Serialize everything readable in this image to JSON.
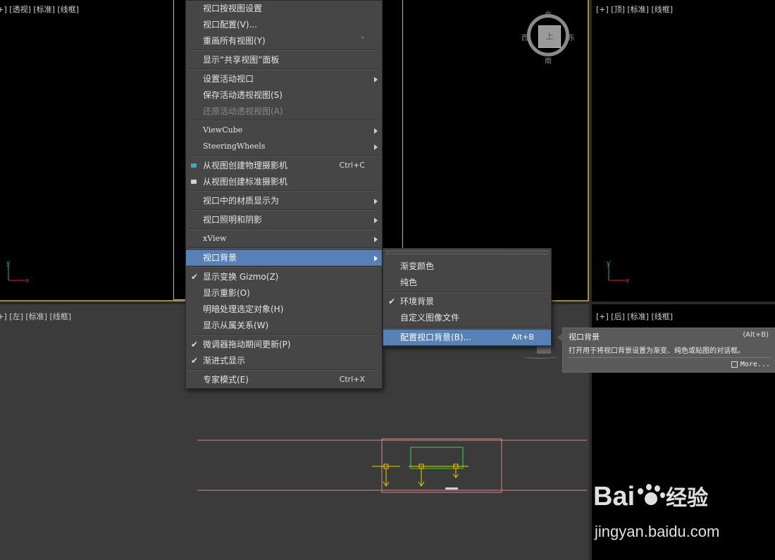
{
  "viewports": {
    "perspective": {
      "label": "[+] [透视] [标准] [线框]"
    },
    "top": {
      "label": "[+] [顶] [标准] [线框]"
    },
    "left": {
      "label": "[+] [左] [标准] [线框]"
    },
    "back": {
      "label": "[+] [后] [标准] [线框]"
    }
  },
  "viewcube": {
    "north": "北",
    "south": "南",
    "east": "东",
    "west": "西",
    "face": "上"
  },
  "context_menu": {
    "items": [
      {
        "label": "视口按视图设置"
      },
      {
        "label": "视口配置(V)..."
      },
      {
        "label": "重画所有视图(Y)",
        "shortcut": "`"
      },
      {
        "label": "显示“共享视图”面板"
      },
      {
        "label": "设置活动视口"
      },
      {
        "label": "保存活动透视视图(S)"
      },
      {
        "label": "还原活动透视视图(A)"
      },
      {
        "label": "ViewCube"
      },
      {
        "label": "SteeringWheels"
      },
      {
        "label": "从视图创建物理摄影机",
        "shortcut": "Ctrl+C"
      },
      {
        "label": "从视图创建标准摄影机"
      },
      {
        "label": "视口中的材质显示为"
      },
      {
        "label": "视口照明和阴影"
      },
      {
        "label": "xView"
      },
      {
        "label": "视口背景"
      },
      {
        "label": "显示变换 Gizmo(Z)"
      },
      {
        "label": "显示重影(O)"
      },
      {
        "label": "明暗处理选定对象(H)"
      },
      {
        "label": "显示从属关系(W)"
      },
      {
        "label": "微调器拖动期间更新(P)"
      },
      {
        "label": "渐进式显示"
      },
      {
        "label": "专家模式(E)",
        "shortcut": "Ctrl+X"
      }
    ]
  },
  "submenu": {
    "items": [
      {
        "label": "渐变颜色"
      },
      {
        "label": "纯色"
      },
      {
        "label": "环境背景"
      },
      {
        "label": "自定义图像文件"
      },
      {
        "label": "配置视口背景(B)...",
        "shortcut": "Alt+B"
      }
    ]
  },
  "tooltip": {
    "title": "视口背景",
    "shortcut": "(Alt+B)",
    "description": "打开用于将视口背景设置为渐变、纯色或贴图的对话框。",
    "more": "More..."
  },
  "watermark": {
    "brand_left": "Bai",
    "brand_right": "经验",
    "url": "jingyan.baidu.com"
  },
  "colors": {
    "highlight": "#5680b6",
    "menu_bg": "#464646",
    "viewport_dark": "#000000",
    "viewport_gray": "#3b3b3b",
    "axis_x": "#d03030",
    "axis_y": "#30c030",
    "accent_yellow": "#e8d000"
  }
}
